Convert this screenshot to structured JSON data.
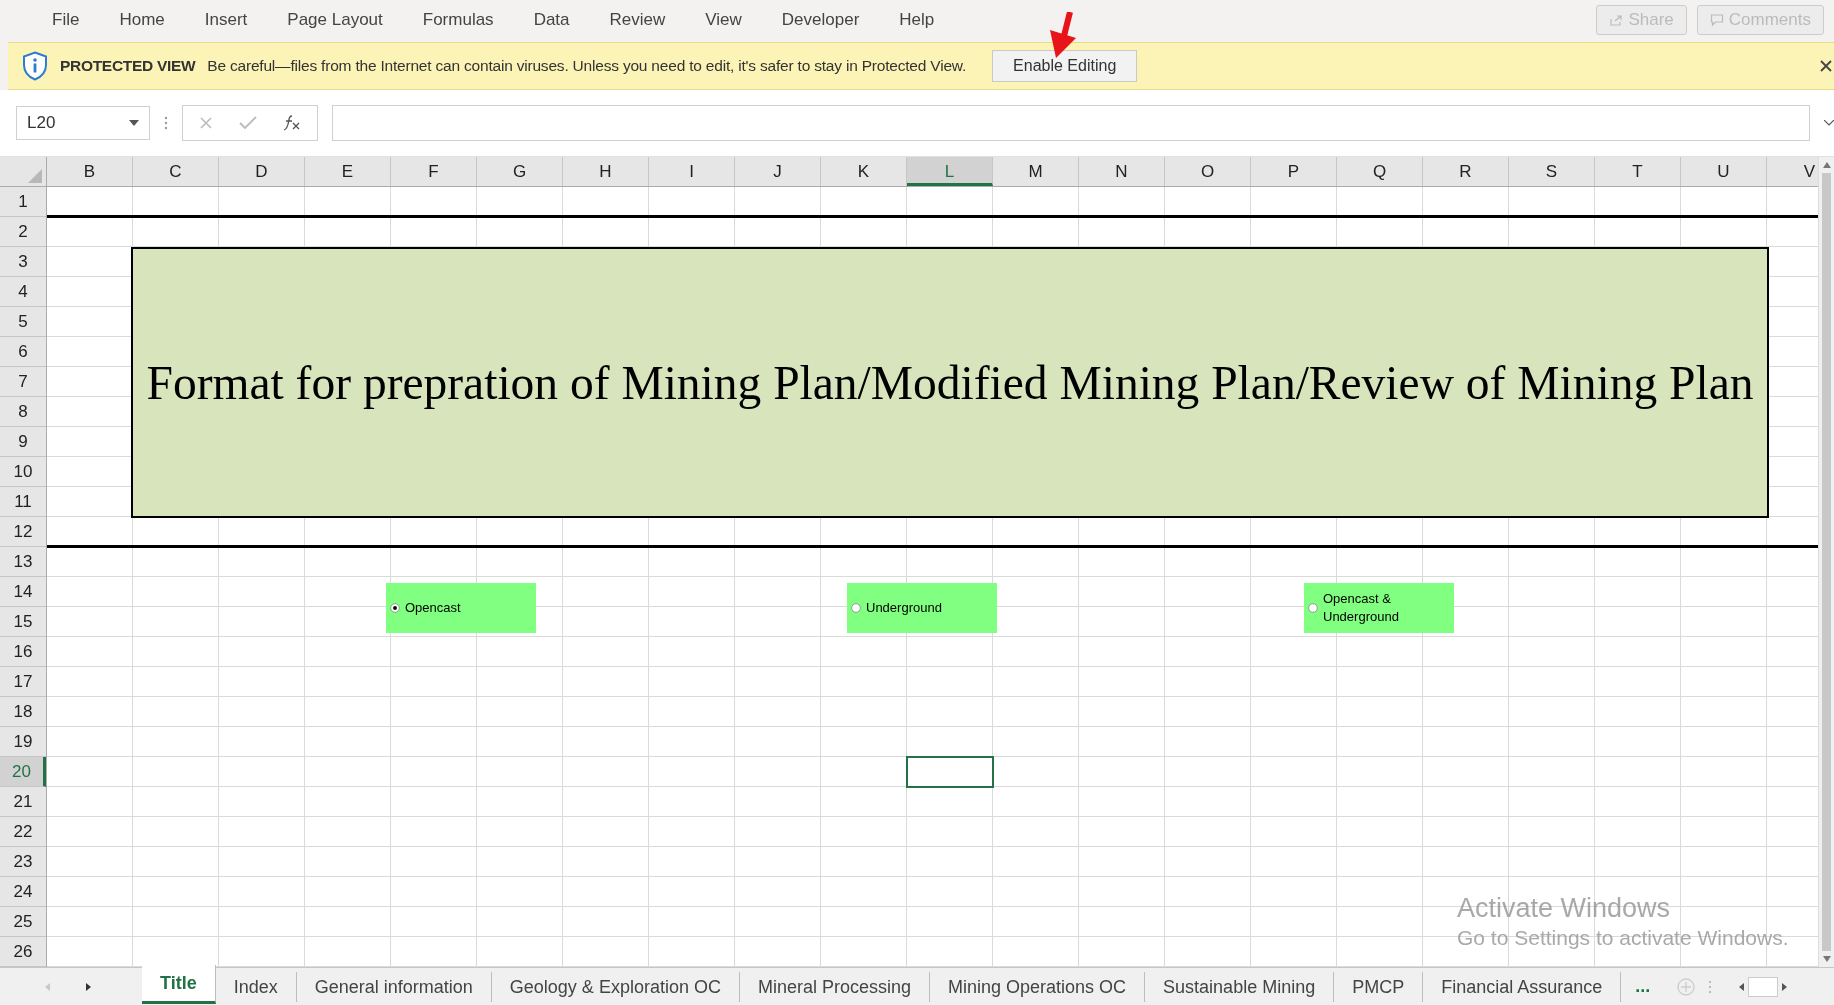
{
  "menu": [
    {
      "label": "File"
    },
    {
      "label": "Home"
    },
    {
      "label": "Insert"
    },
    {
      "label": "Page Layout"
    },
    {
      "label": "Formulas"
    },
    {
      "label": "Data"
    },
    {
      "label": "Review"
    },
    {
      "label": "View"
    },
    {
      "label": "Developer"
    },
    {
      "label": "Help"
    }
  ],
  "share_button": {
    "label": "Share",
    "disabled": true
  },
  "comments_button": {
    "label": "Comments",
    "disabled": true
  },
  "protected_view": {
    "title": "PROTECTED VIEW",
    "message": "Be careful—files from the Internet can contain viruses. Unless you need to edit, it's safer to stay in Protected View.",
    "button": "Enable Editing"
  },
  "name_box": {
    "value": "L20"
  },
  "columns": [
    {
      "label": "B",
      "selected": false
    },
    {
      "label": "C",
      "selected": false
    },
    {
      "label": "D",
      "selected": false
    },
    {
      "label": "E",
      "selected": false
    },
    {
      "label": "F",
      "selected": false
    },
    {
      "label": "G",
      "selected": false
    },
    {
      "label": "H",
      "selected": false
    },
    {
      "label": "I",
      "selected": false
    },
    {
      "label": "J",
      "selected": false
    },
    {
      "label": "K",
      "selected": false
    },
    {
      "label": "L",
      "selected": true
    },
    {
      "label": "M",
      "selected": false
    },
    {
      "label": "N",
      "selected": false
    },
    {
      "label": "O",
      "selected": false
    },
    {
      "label": "P",
      "selected": false
    },
    {
      "label": "Q",
      "selected": false
    },
    {
      "label": "R",
      "selected": false
    },
    {
      "label": "S",
      "selected": false
    },
    {
      "label": "T",
      "selected": false
    },
    {
      "label": "U",
      "selected": false
    },
    {
      "label": "V",
      "selected": false
    }
  ],
  "rows": [
    {
      "label": "1",
      "selected": false
    },
    {
      "label": "2",
      "selected": false
    },
    {
      "label": "3",
      "selected": false
    },
    {
      "label": "4",
      "selected": false
    },
    {
      "label": "5",
      "selected": false
    },
    {
      "label": "6",
      "selected": false
    },
    {
      "label": "7",
      "selected": false
    },
    {
      "label": "8",
      "selected": false
    },
    {
      "label": "9",
      "selected": false
    },
    {
      "label": "10",
      "selected": false
    },
    {
      "label": "11",
      "selected": false
    },
    {
      "label": "12",
      "selected": false
    },
    {
      "label": "13",
      "selected": false
    },
    {
      "label": "14",
      "selected": false
    },
    {
      "label": "15",
      "selected": false
    },
    {
      "label": "16",
      "selected": false
    },
    {
      "label": "17",
      "selected": false
    },
    {
      "label": "18",
      "selected": false
    },
    {
      "label": "19",
      "selected": false
    },
    {
      "label": "20",
      "selected": true
    },
    {
      "label": "21",
      "selected": false
    },
    {
      "label": "22",
      "selected": false
    },
    {
      "label": "23",
      "selected": false
    },
    {
      "label": "24",
      "selected": false
    },
    {
      "label": "25",
      "selected": false
    },
    {
      "label": "26",
      "selected": false
    }
  ],
  "title": "Format for prepration of Mining Plan/Modified Mining Plan/Review of Mining Plan",
  "options": [
    {
      "label": "Opencast",
      "selected": true
    },
    {
      "label": "Underground",
      "selected": false
    },
    {
      "label": "Opencast & Underground",
      "selected": false
    }
  ],
  "sheet_tabs": [
    {
      "label": "Title",
      "selected": true
    },
    {
      "label": "Index",
      "selected": false
    },
    {
      "label": "General information",
      "selected": false
    },
    {
      "label": "Geology & Exploration OC",
      "selected": false
    },
    {
      "label": "Mineral Processing",
      "selected": false
    },
    {
      "label": "Mining Operations OC",
      "selected": false
    },
    {
      "label": "Sustainable Mining",
      "selected": false
    },
    {
      "label": "PMCP",
      "selected": false
    },
    {
      "label": "Financial Assurance",
      "selected": false
    }
  ],
  "more_tabs": "...",
  "activation_notice": {
    "title": "Activate Windows",
    "message": "Go to Settings to activate Windows."
  }
}
